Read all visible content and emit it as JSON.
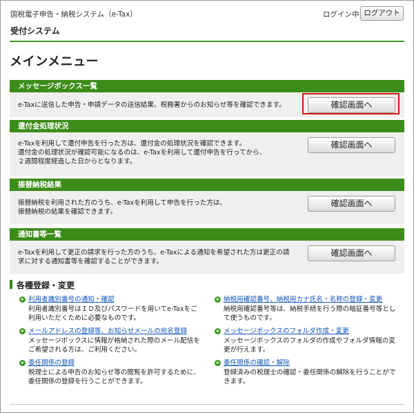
{
  "header": {
    "system_name": "国税電子申告・納税システム（e-Tax）",
    "subsystem_name": "受付システム",
    "login_status": "ログイン中",
    "logout_label": "ログアウト"
  },
  "page_title": "メインメニュー",
  "sections": [
    {
      "title": "メッセージボックス一覧",
      "lines": [
        "e-Taxに送信した申告・申請データの送信結果、税務署からのお知らせ等を確認できます。"
      ],
      "button": "確認画面へ",
      "highlighted": true
    },
    {
      "title": "還付金処理状況",
      "lines": [
        "e-Taxを利用して還付申告を行った方は、還付金の処理状況を確認できます。",
        "還付金の処理状況が確認可能になるのは、e-Taxを利用して還付申告を行ってから、",
        "２週間程度経過した日からとなります。"
      ],
      "button": "確認画面へ",
      "highlighted": false
    },
    {
      "title": "振替納税結果",
      "lines": [
        "振替納税を利用された方のうち、e-Taxを利用して申告を行った方は、",
        "振替納税の結果を確認できます。"
      ],
      "button": "確認画面へ",
      "highlighted": false
    },
    {
      "title": "通知書等一覧",
      "lines": [
        "e-Taxを利用して更正の請求を行った方のうち、e-Taxによる通知を希望された方は更正の請",
        "求に対する通知書等を確認することができます。"
      ],
      "button": "確認画面へ",
      "highlighted": false
    }
  ],
  "registration": {
    "title": "各種登録・変更",
    "items": [
      {
        "link": "利用者識別番号の通知・確認",
        "desc": [
          "利用者識別番号はＩＤ及びパスワードを用いてe-Taxをご",
          "利用いただくために必要なものです。"
        ]
      },
      {
        "link": "納税用確認番号、納税用カナ氏名・名称の登録・変更",
        "desc": [
          "納税用確認番号等は、納税手続を行う際の暗証番号等とし",
          "て使うものです。"
        ]
      },
      {
        "link": "メールアドレスの登録等、お知らせメールの宛名登録",
        "desc": [
          "メッセージボックスに情報が格納された際のメール配信を",
          "ご希望される方は、ご利用ください。"
        ]
      },
      {
        "link": "メッセージボックスのフォルダ作成・変更",
        "desc": [
          "メッセージボックスのフォルダの作成やフォルダ情報の変",
          "更が行えます。"
        ]
      },
      {
        "link": "委任関係の登録",
        "desc": [
          "税理士による申告のお知らせ等の閲覧を許可するために、",
          "委任関係の登録を行うことができます。"
        ]
      },
      {
        "link": "委任関係の確認・解除",
        "desc": [
          "登録済みの税理士の確認・委任関係の解除を行うことがで",
          "きます。"
        ]
      }
    ]
  },
  "colors": {
    "section_header": "#3c8c19",
    "section_body": "#efefef",
    "link": "#1155bb",
    "highlight": "#e01010"
  }
}
